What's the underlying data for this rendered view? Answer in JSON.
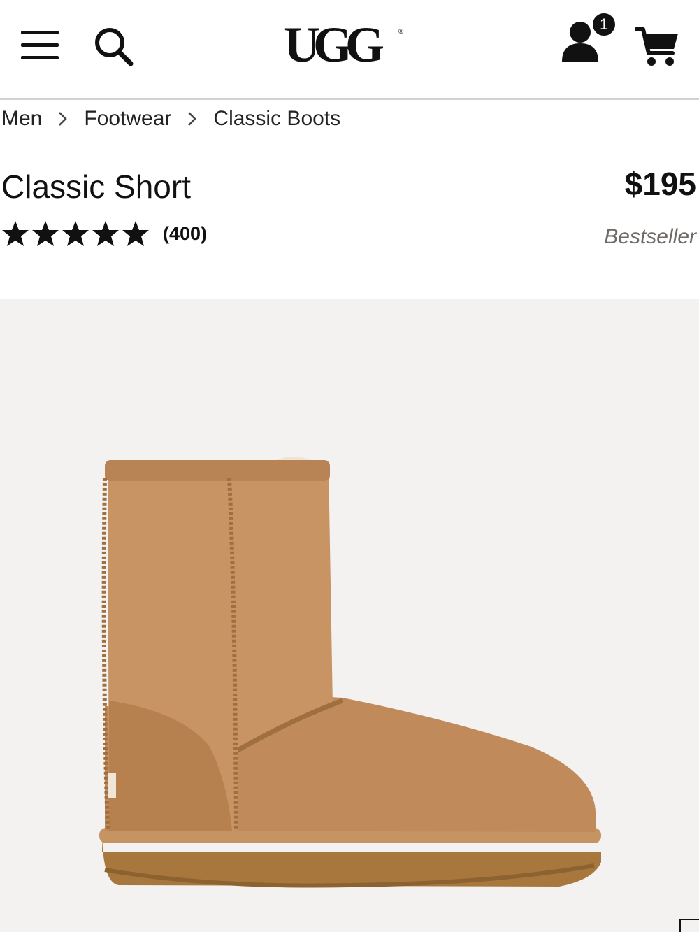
{
  "header": {
    "logo_text": "UGG",
    "account_badge_count": "1",
    "icons": [
      "menu-icon",
      "search-icon",
      "account-icon",
      "cart-icon"
    ]
  },
  "breadcrumb": [
    {
      "label": "Men"
    },
    {
      "label": "Footwear"
    },
    {
      "label": "Classic Boots"
    }
  ],
  "product": {
    "title": "Classic Short",
    "price": "$195",
    "rating": 5,
    "rating_max": 5,
    "review_count": "(400)",
    "badge": "Bestseller",
    "image_alt": "chestnut suede boot"
  },
  "colors": {
    "text": "#111111",
    "badge_text": "#6f6a66",
    "image_bg": "#f3f2f0",
    "boot": "#c08a5b"
  }
}
